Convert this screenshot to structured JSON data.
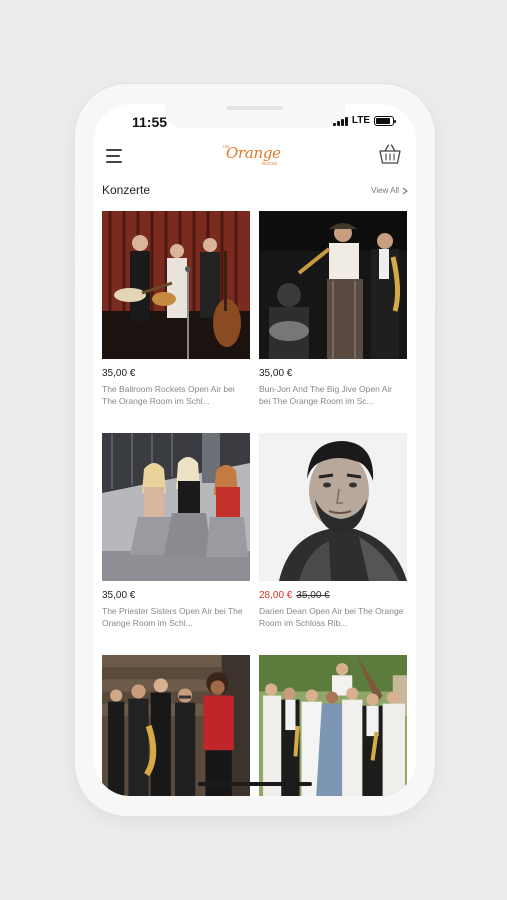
{
  "status_bar": {
    "time": "11:55",
    "network": "LTE",
    "battery_level": 0.85
  },
  "header": {
    "logo": {
      "small_top": "THE",
      "main": "Orange",
      "small_bottom": "ROOM"
    },
    "menu_icon": "hamburger-menu-icon",
    "cart_icon": "basket-icon"
  },
  "section": {
    "title": "Konzerte",
    "view_all": "View All"
  },
  "products": [
    {
      "price": "35,00 €",
      "title": "The Ballroom Rockets Open Air bei The Orange Room im Schl..."
    },
    {
      "price": "35,00 €",
      "title": "Bun-Jon And The Big Jive Open Air bei The Orange Room im Sc..."
    },
    {
      "price": "35,00 €",
      "title": "The Priester Sisters Open Air bei The Orange Room im Schl..."
    },
    {
      "price_sale": "28,00 €",
      "price_old": "35,00 €",
      "title": "Darien Dean Open Air bei The Orange Room im Schloss Rib..."
    },
    {
      "image": "band-photo"
    },
    {
      "image": "big-band-photo"
    }
  ],
  "colors": {
    "accent": "#e07a2a",
    "sale": "#e0302b"
  }
}
